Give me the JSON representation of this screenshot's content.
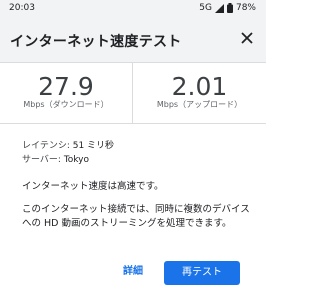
{
  "status_bar": {
    "time": "20:03",
    "network": "5G",
    "battery": "78%",
    "icons": [
      "signal-icon",
      "battery-icon"
    ]
  },
  "header": {
    "title": "インターネット速度テスト",
    "close_icon": "close-icon"
  },
  "download": {
    "value": "27.9",
    "unit_label": "Mbps（ダウンロード）"
  },
  "upload": {
    "value": "2.01",
    "unit_label": "Mbps（アップロード）"
  },
  "details": {
    "latency_label": "レイテンシ: ",
    "latency_value": "51 ミリ秒",
    "server_label": "サーバー: ",
    "server_value": "Tokyo"
  },
  "result": "インターネット速度は高速です。",
  "description": "このインターネット接続では、同時に複数のデバイスへの HD 動画のストリーミングを処理できます。",
  "buttons": {
    "details_label": "詳細",
    "retest_label": "再テスト"
  },
  "colors": {
    "accent": "#1a73e8",
    "header_bg": "#f1f3f4",
    "divider": "#dadce0"
  }
}
